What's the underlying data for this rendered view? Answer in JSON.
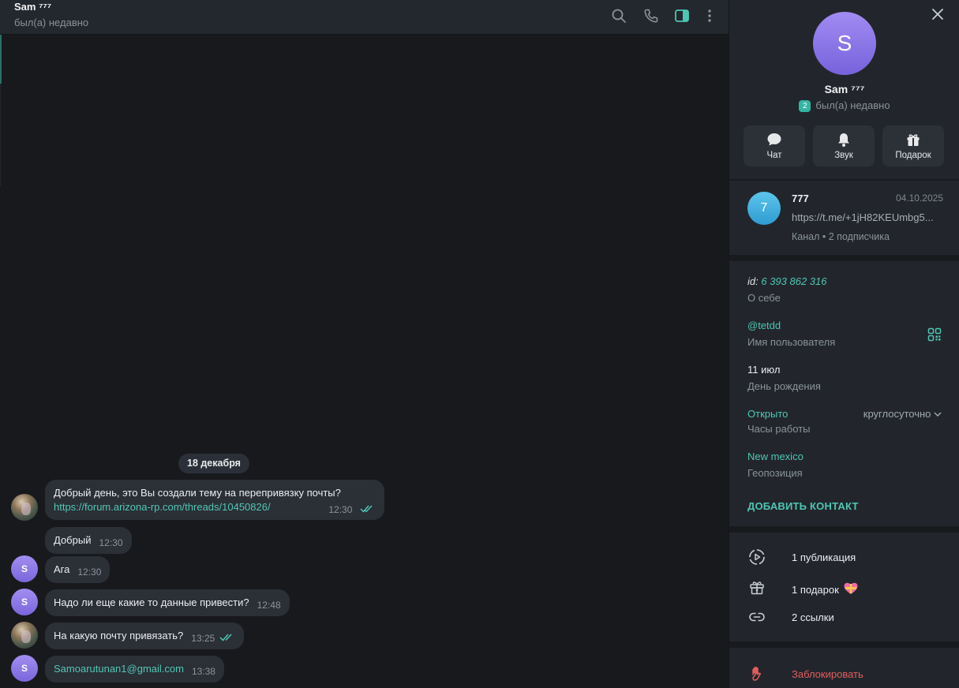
{
  "chat": {
    "title": "Sam ⁷⁷⁷",
    "status": "был(а) недавно",
    "date_divider": "18 декабря",
    "messages": [
      {
        "from": "me",
        "line1": "Добрый день, это Вы создали тему на перепривязку почты?",
        "link": "https://forum.arizona-rp.com/threads/10450826/",
        "time": "12:30"
      },
      {
        "from": "me",
        "text": "Добрый",
        "time": "12:30"
      },
      {
        "from": "sam",
        "text": "Ага",
        "time": "12:30"
      },
      {
        "from": "sam",
        "text": "Надо ли еще какие то данные привести?",
        "time": "12:48"
      },
      {
        "from": "me",
        "text": "На какую почту привязать?",
        "time": "13:25"
      },
      {
        "from": "sam",
        "text": "Samoarutunan1@gmail.com",
        "time": "13:38"
      }
    ],
    "sam_initial": "S"
  },
  "header_icons": [
    "search-icon",
    "phone-icon",
    "sidebar-toggle-icon",
    "more-vertical-icon"
  ],
  "panel": {
    "avatar_letter": "S",
    "name": "Sam ⁷⁷⁷",
    "badge": "2",
    "status": "был(а) недавно",
    "actions": [
      {
        "label": "Чат",
        "icon": "chat-icon"
      },
      {
        "label": "Звук",
        "icon": "bell-icon"
      },
      {
        "label": "Подарок",
        "icon": "gift-icon"
      }
    ],
    "channel": {
      "letter": "7",
      "name": "777",
      "date": "04.10.2025",
      "link": "https://t.me/+1jH82KEUmbg5...",
      "meta": "Канал • 2 подписчика"
    },
    "info": {
      "id_prefix": "id:",
      "id_value": "6 393 862 316",
      "about_label": "О себе",
      "username": "@tetdd",
      "username_label": "Имя пользователя",
      "birthday": "11 июл",
      "birthday_label": "День рождения",
      "hours_status": "Открыто",
      "hours_value": "круглосуточно",
      "hours_label": "Часы работы",
      "location": "New mexico",
      "location_label": "Геопозиция",
      "add_contact": "ДОБАВИТЬ КОНТАКТ"
    },
    "rows": [
      {
        "icon": "stories-icon",
        "text": "1 публикация"
      },
      {
        "icon": "gift-icon",
        "text": "1 подарок"
      },
      {
        "icon": "link-icon",
        "text": "2 ссылки"
      }
    ],
    "block": "Заблокировать"
  },
  "colors": {
    "accent": "#4fc6b3",
    "danger": "#e35d5d",
    "avatar_purple": "#8a76e6",
    "channel_blue": "#3ca9dc"
  }
}
